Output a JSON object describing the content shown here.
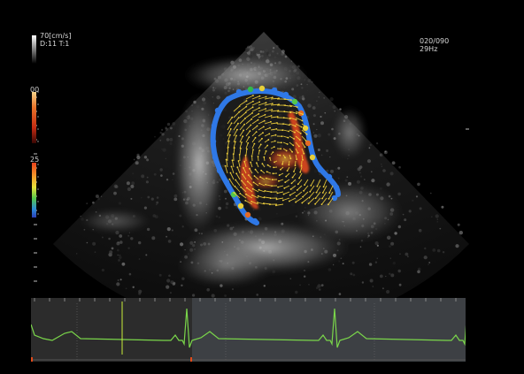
{
  "velocity_scale": {
    "top": "70[cm/s]",
    "second": "D:11 T:1"
  },
  "frame": {
    "counter": "020/090",
    "rate": "29Hz"
  },
  "color_bar_labels": {
    "red_bar": "00",
    "rainbow_bar": "25"
  },
  "colors": {
    "background": "#000000",
    "ecg_trace": "#7ad64a",
    "ecg_marker": "#c9ec3a",
    "vector_arrows": "#f2d23c",
    "vortex_red": "#e0491f",
    "border_blue": "#2f78e6",
    "ecg_panel": "#2c2c2c",
    "ecg_panel_played": "#3d4044"
  }
}
